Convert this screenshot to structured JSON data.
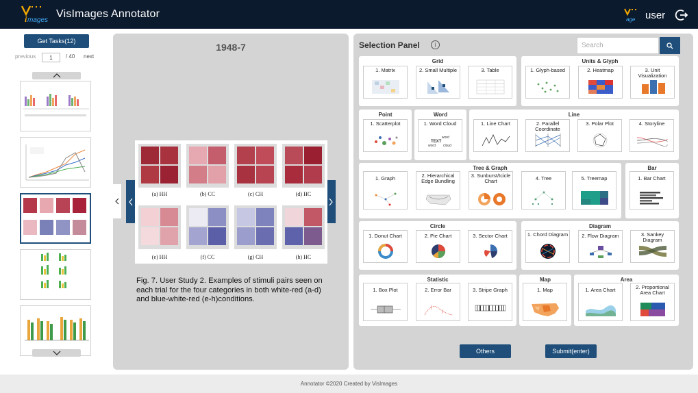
{
  "header": {
    "title": "VisImages Annotator",
    "logo_text": "Images",
    "user": "user"
  },
  "left": {
    "get_tasks": "Get Tasks(12)",
    "previous": "previous",
    "page_value": "1",
    "total": "/ 40",
    "next": "next"
  },
  "center": {
    "image_id": "1948-7",
    "caption": "Fig. 7.  User Study 2.  Examples of stimuli pairs seen on each trial for the four categories in both white-red (a-d) and blue-white-red (e-h)conditions.",
    "labels": [
      "(a)  HH",
      "(b)  CC",
      "(c)  CH",
      "(d)  HC",
      "(e)  HH",
      "(f)  CC",
      "(g)  CH",
      "(h)  HC"
    ]
  },
  "panel": {
    "title": "Selection Panel",
    "search_placeholder": "Search",
    "groups": {
      "grid": {
        "title": "Grid",
        "items": [
          "1. Matrix",
          "2. Small Multiple",
          "3. Table"
        ]
      },
      "units": {
        "title": "Units & Glyph",
        "items": [
          "1. Glyph-based",
          "2. Heatmap",
          "3. Unit Visualization"
        ]
      },
      "point": {
        "title": "Point",
        "items": [
          "1. Scatterplot"
        ]
      },
      "word": {
        "title": "Word",
        "items": [
          "1. Word Cloud"
        ]
      },
      "line": {
        "title": "Line",
        "items": [
          "1. Line Chart",
          "2. Parallel Coordinate",
          "3. Polar Plot",
          "4. Storyline"
        ]
      },
      "tree": {
        "title": "Tree & Graph",
        "items": [
          "1. Graph",
          "2. Hierarchical Edge Bundling",
          "3. Sunburst/Icicle Chart",
          "4. Tree",
          "5. Treemap"
        ]
      },
      "bar": {
        "title": "Bar",
        "items": [
          "1. Bar Chart"
        ]
      },
      "circle": {
        "title": "Circle",
        "items": [
          "1. Donut Chart",
          "2. Pie Chart",
          "3. Sector Chart"
        ]
      },
      "diagram": {
        "title": "Diagram",
        "items": [
          "1. Chord Diagram",
          "2. Flow Diagram",
          "3. Sankey Diagram"
        ]
      },
      "statistic": {
        "title": "Statistic",
        "items": [
          "1. Box Plot",
          "2. Error Bar",
          "3. Stripe Graph"
        ]
      },
      "map": {
        "title": "Map",
        "items": [
          "1. Map"
        ]
      },
      "area": {
        "title": "Area",
        "items": [
          "1. Area Chart",
          "2. Proportional Area Chart"
        ]
      }
    },
    "others": "Others",
    "submit": "Submit(enter)"
  },
  "footer": "Annotator ©2020 Created by VisImages",
  "colors": {
    "header_bg": "#0c1a2e",
    "accent": "#1e4e79",
    "panel_bg": "#d4d4d4"
  }
}
